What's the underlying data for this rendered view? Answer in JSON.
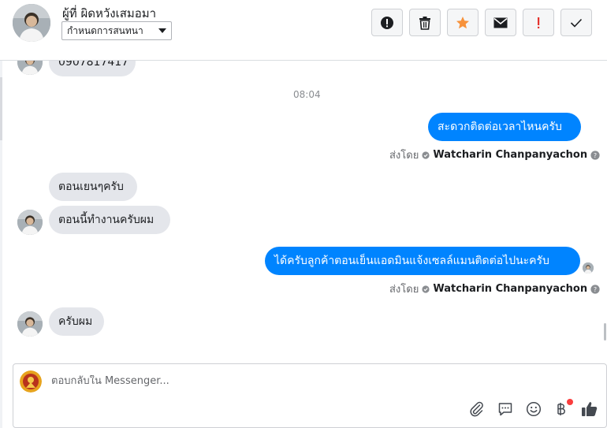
{
  "header": {
    "contact_name": "ผู้ที่ ผิดหวังเสมอมา",
    "assign_label": "กำหนดการสนทนา",
    "toolbar": [
      {
        "name": "spam-icon"
      },
      {
        "name": "trash-icon"
      },
      {
        "name": "star-icon",
        "color": "#f7923b"
      },
      {
        "name": "envelope-icon"
      },
      {
        "name": "exclamation-icon",
        "color": "#e4332d"
      },
      {
        "name": "checkmark-icon"
      }
    ]
  },
  "thread": {
    "cut_message": "0907817417",
    "timestamp": "08:04",
    "messages": [
      {
        "direction": "out",
        "text": "สะดวกติดต่อเวลาไหนครับ",
        "sent_by_label": "ส่งโดย",
        "sender": "Watcharin Chanpanyachon"
      },
      {
        "direction": "in",
        "text": "ตอนเยนๆครับ"
      },
      {
        "direction": "in",
        "text": "ตอนนี้ทำงานครับผม"
      },
      {
        "direction": "out",
        "text": "ได้ครับลูกค้าตอนเย็นแอดมินแจ้งเซลล์แมนติดต่อไปนะครับ",
        "sent_by_label": "ส่งโดย",
        "sender": "Watcharin Chanpanyachon"
      },
      {
        "direction": "in",
        "text": "ครับผม"
      }
    ]
  },
  "composer": {
    "placeholder": "ตอบกลับใน Messenger...",
    "icons": [
      "paperclip-icon",
      "saved-replies-icon",
      "emoji-icon",
      "baht-payment-icon",
      "thumbs-up-icon"
    ],
    "accent": "#0084ff"
  }
}
